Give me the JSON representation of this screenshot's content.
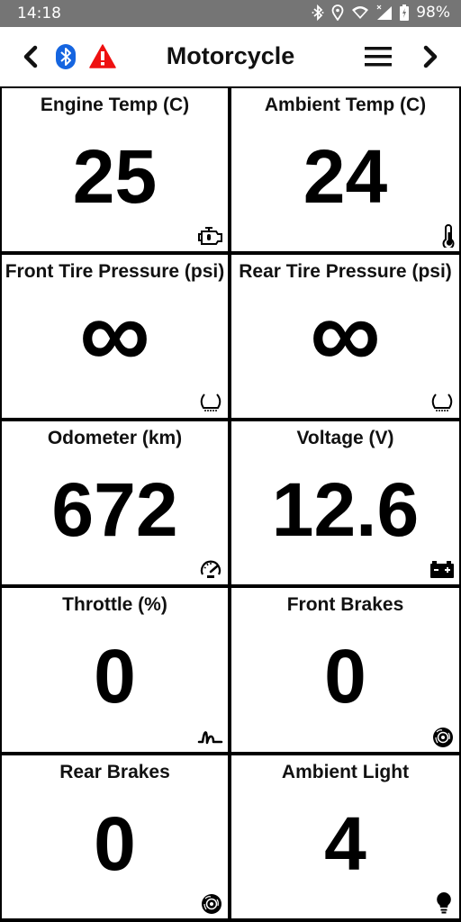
{
  "status_bar": {
    "time": "14:18",
    "battery": "98%",
    "icons": [
      "bluetooth-icon",
      "location-icon",
      "wifi-icon",
      "signal-icon",
      "battery-charging-icon"
    ]
  },
  "app_bar": {
    "title": "Motorcycle",
    "icons": [
      "back-chevron-icon",
      "bluetooth-icon",
      "warning-icon",
      "menu-icon",
      "forward-chevron-icon"
    ],
    "colors": {
      "bluetooth": "#1565e0",
      "warning": "#ee1111"
    }
  },
  "tiles": [
    {
      "label": "Engine Temp (C)",
      "value": "25",
      "icon": "engine-icon"
    },
    {
      "label": "Ambient Temp (C)",
      "value": "24",
      "icon": "thermometer-icon"
    },
    {
      "label": "Front Tire Pressure (psi)",
      "value": "∞",
      "icon": "tire-icon"
    },
    {
      "label": "Rear Tire Pressure (psi)",
      "value": "∞",
      "icon": "tire-icon"
    },
    {
      "label": "Odometer (km)",
      "value": "672",
      "icon": "speedometer-icon"
    },
    {
      "label": "Voltage (V)",
      "value": "12.6",
      "icon": "battery-icon"
    },
    {
      "label": "Throttle (%)",
      "value": "0",
      "icon": "throttle-icon"
    },
    {
      "label": "Front Brakes",
      "value": "0",
      "icon": "brake-disc-icon"
    },
    {
      "label": "Rear Brakes",
      "value": "0",
      "icon": "brake-disc-icon"
    },
    {
      "label": "Ambient Light",
      "value": "4",
      "icon": "lightbulb-icon"
    }
  ]
}
